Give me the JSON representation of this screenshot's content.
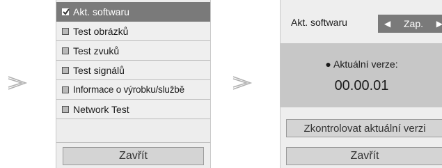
{
  "menu": {
    "items": [
      {
        "label": "Akt. softwaru",
        "checked": true,
        "selected": true
      },
      {
        "label": "Test obrázků",
        "checked": false,
        "selected": false
      },
      {
        "label": "Test zvuků",
        "checked": false,
        "selected": false
      },
      {
        "label": "Test signálů",
        "checked": false,
        "selected": false
      },
      {
        "label": "Informace o výrobku/službě",
        "checked": false,
        "selected": false
      },
      {
        "label": "Network Test",
        "checked": false,
        "selected": false
      }
    ],
    "close_label": "Zavřít"
  },
  "panel": {
    "title": "Akt. softwaru",
    "toggle": {
      "left_arrow": "◀",
      "value": "Zap.",
      "right_arrow": "▶"
    },
    "version_label": "● Aktuální verze:",
    "version_value": "00.00.01",
    "check_label": "Zkontrolovat aktuální verzi",
    "close_label": "Zavřít"
  },
  "colors": {
    "selected_bg": "#7a7a7a",
    "panel_bg": "#eeeeee",
    "info_bg": "#c7c7c7",
    "button_bg": "#d4d4d4",
    "arrow": "#b0b0b0"
  },
  "icons": {
    "step_arrow": "double-chevron-right-icon",
    "checkbox_checked": "checkbox-checked-icon",
    "checkbox_empty": "checkbox-empty-icon"
  }
}
